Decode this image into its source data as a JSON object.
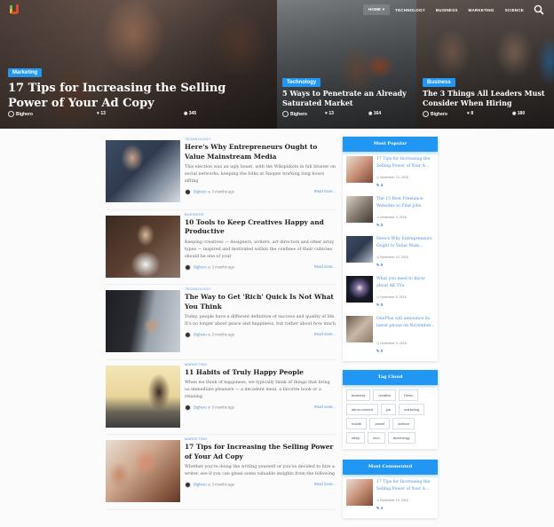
{
  "nav": {
    "items": [
      {
        "label": "HOME ▾",
        "active": true
      },
      {
        "label": "TECHNOLOGY"
      },
      {
        "label": "BUSINESS"
      },
      {
        "label": "MARKETING"
      },
      {
        "label": "SCIENCE"
      }
    ],
    "search_icon": "search-icon",
    "logo_icon": "site-logo-icon"
  },
  "hero": [
    {
      "category": "Marketing",
      "title": "17 Tips for Increasing the Selling Power of Your Ad Copy",
      "author": "Bighero",
      "likes": "13",
      "views": "345"
    },
    {
      "category": "Technology",
      "title": "5 Ways to Penetrate an Already Saturated Market",
      "author": "Bighero",
      "likes": "13",
      "views": "164"
    },
    {
      "category": "Business",
      "title": "The 3 Things All Leaders Must Consider When Hiring",
      "author": "Bighero",
      "likes": "8",
      "views": "180"
    }
  ],
  "articles": [
    {
      "category": "TECHNOLOGY",
      "title": "Here's Why Entrepreneurs Ought to Value Mainstream Media",
      "excerpt": "This election was an ugly beast, with the Wikipidiots in full bluster on social networks, keeping the folks at Snopes working long hours sifting",
      "author": "Bighero",
      "time": "3 months ago",
      "read_more": "Read more..."
    },
    {
      "category": "BUSINESS",
      "title": "10 Tools to Keep Creatives Happy and Productive",
      "excerpt": "Keeping creatives — designers, writers, art directors and other artsy types — inspired and motivated within the confines of their cubicles should be one of your",
      "author": "Bighero",
      "time": "3 months ago",
      "read_more": "Read more..."
    },
    {
      "category": "TECHNOLOGY",
      "title": "The Way to Get 'Rich' Quick Is Not What You Think",
      "excerpt": "Today, people have a different definition of success and quality of life. It's no longer about peace and happiness, but rather about how much",
      "author": "Bighero",
      "time": "3 months ago",
      "read_more": "Read more..."
    },
    {
      "category": "MARKETING",
      "title": "11 Habits of Truly Happy People",
      "excerpt": "When we think of happiness, we typically think of things that bring us immediate pleasure — a decadent meal, a favorite book or a relaxing",
      "author": "Bighero",
      "time": "3 months ago",
      "read_more": "Read more..."
    },
    {
      "category": "MARKETING",
      "title": "17 Tips for Increasing the Selling Power of Your Ad Copy",
      "excerpt": "Whether you're doing the writing yourself or you've decided to hire a writer, see if you can glean some valuable insights from the following",
      "author": "Bighero",
      "time": "3 months ago",
      "read_more": "Read more..."
    }
  ],
  "sidebar": {
    "most_popular": {
      "heading": "Most Popular",
      "items": [
        {
          "title": "17 Tips for Increasing the Selling Power of Your A...",
          "date": "November 10, 2016",
          "comments": "4"
        },
        {
          "title": "The 15 Best Freelance Websites to Find Jobs",
          "date": "November 9, 2016",
          "comments": "2"
        },
        {
          "title": "Here's Why Entrepreneurs Ought to Value Main...",
          "date": "November 10, 2016",
          "comments": "0"
        },
        {
          "title": "What you need to know about 4K TVs",
          "date": "November 8, 2016",
          "comments": "0"
        },
        {
          "title": "OnePlus will announce its latest phone on November...",
          "date": "November 9, 2016",
          "comments": "0"
        }
      ]
    },
    "tag_cloud": {
      "heading": "Tag Cloud",
      "tags": [
        "business",
        "creative",
        "Demo",
        "demo-content",
        "job",
        "marketing",
        "mobile",
        "planet",
        "science",
        "sleep",
        "tech",
        "technology"
      ]
    },
    "most_commented": {
      "heading": "Most Commented",
      "items": [
        {
          "title": "17 Tips for Increasing the Selling Power of Your A...",
          "date": "November 10, 2016",
          "comments": "4"
        }
      ]
    }
  }
}
